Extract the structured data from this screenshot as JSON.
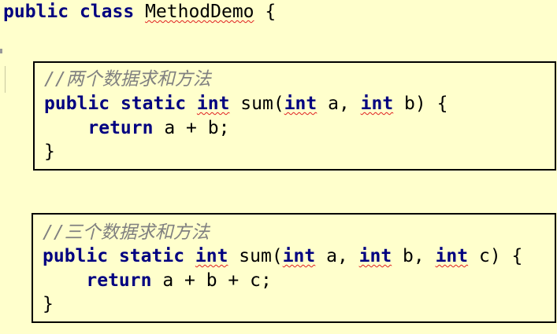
{
  "editor": {
    "header": {
      "kw_public": "public",
      "kw_class": "class",
      "class_name": "MethodDemo",
      "brace": " {"
    },
    "blocks": [
      {
        "comment": "//两个数据求和方法",
        "sig_public": "public",
        "sig_static": "static",
        "sig_type": "int",
        "sig_name": " sum(",
        "p1_type": "int",
        "p1_name": " a, ",
        "p2_type": "int",
        "p2_name": " b) {",
        "ret_kw": "return",
        "ret_expr": " a + b;",
        "close": "}"
      },
      {
        "comment": "//三个数据求和方法",
        "sig_public": "public",
        "sig_static": "static",
        "sig_type": "int",
        "sig_name": " sum(",
        "p1_type": "int",
        "p1_name": " a, ",
        "p2_type": "int",
        "p2_name": " b, ",
        "p3_type": "int",
        "p3_name": " c) {",
        "ret_kw": "return",
        "ret_expr": " a + b + c;",
        "close": "}"
      }
    ]
  }
}
